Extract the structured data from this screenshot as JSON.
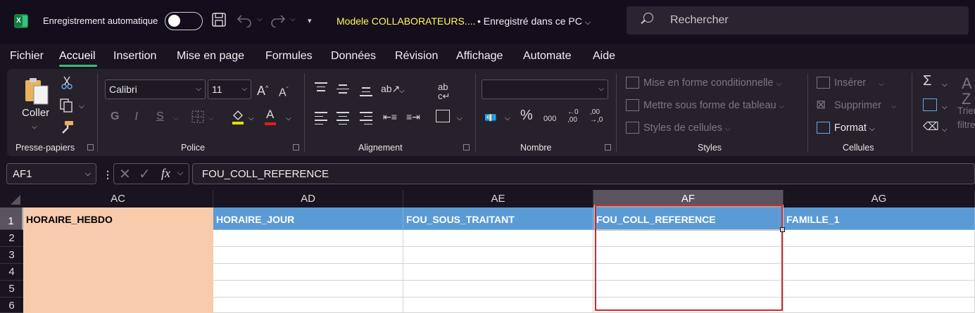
{
  "titlebar": {
    "autosave_label": "Enregistrement automatique",
    "autosave_on": false,
    "doc_name": "Modele COLLABORATEURS....",
    "doc_status": "• Enregistré dans ce PC",
    "search_placeholder": "Rechercher"
  },
  "tabs": [
    "Fichier",
    "Accueil",
    "Insertion",
    "Mise en page",
    "Formules",
    "Données",
    "Révision",
    "Affichage",
    "Automate",
    "Aide"
  ],
  "active_tab": "Accueil",
  "ribbon": {
    "clipboard": {
      "label": "Presse-papiers",
      "paste_label": "Coller"
    },
    "font": {
      "label": "Police",
      "font_name": "Calibri",
      "font_size": "11"
    },
    "alignment": {
      "label": "Alignement"
    },
    "number": {
      "label": "Nombre",
      "format": ""
    },
    "styles": {
      "label": "Styles",
      "conditional": "Mise en forme conditionnelle",
      "as_table": "Mettre sous forme de tableau",
      "cell_styles": "Styles de cellules"
    },
    "cells": {
      "label": "Cellules",
      "insert": "Insérer",
      "delete": "Supprimer",
      "format": "Format"
    },
    "editing": {
      "sort_partial": "Trier",
      "filter_partial": "filtre"
    }
  },
  "formula_bar": {
    "name_box": "AF1",
    "formula": "FOU_COLL_REFERENCE"
  },
  "sheet": {
    "columns": [
      "AC",
      "AD",
      "AE",
      "AF",
      "AG"
    ],
    "selected_column": "AF",
    "rows": [
      "1",
      "2",
      "3",
      "4",
      "5",
      "6"
    ],
    "header_row": [
      "HORAIRE_HEBDO",
      "HORAIRE_JOUR",
      "FOU_SOUS_TRAITANT",
      "FOU_COLL_REFERENCE",
      "FAMILLE_1"
    ]
  },
  "colors": {
    "peach_fill": "#f8cbad",
    "blue_fill": "#5b9bd5",
    "selection_highlight": "#cc2a2a",
    "accent_tab": "#3fb878",
    "doc_name": "#fffb5a"
  }
}
